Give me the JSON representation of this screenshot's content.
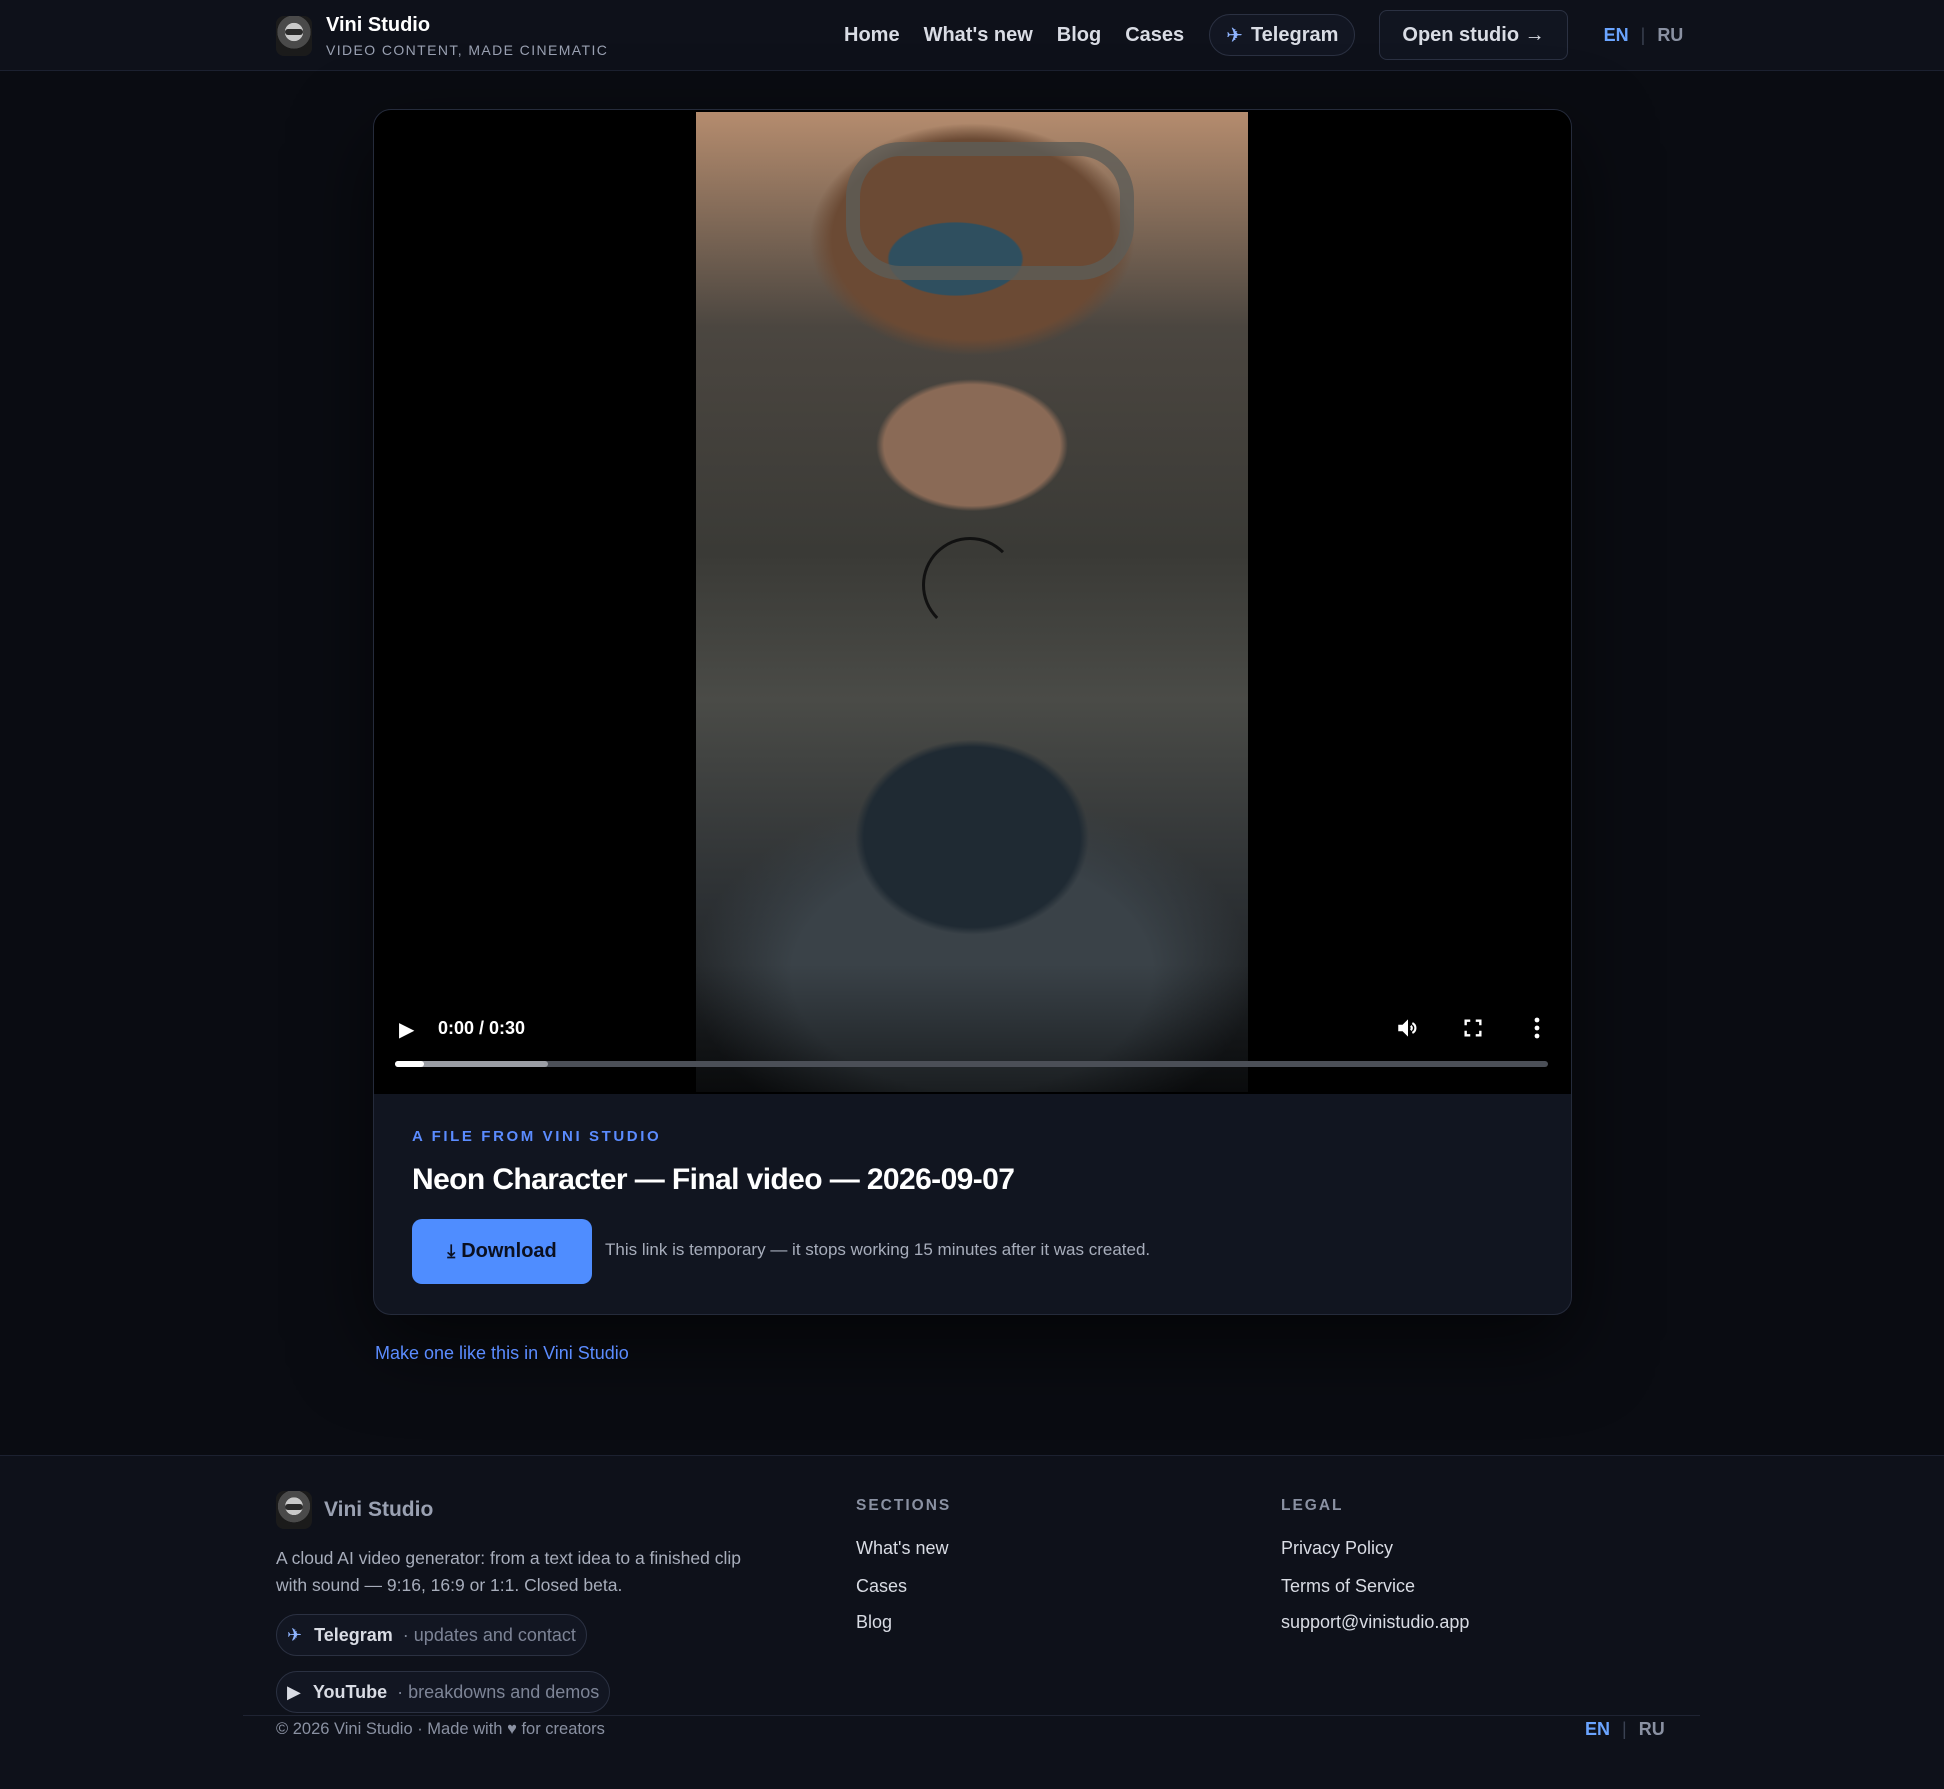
{
  "header": {
    "brand_name": "Vini Studio",
    "brand_tagline": "VIDEO CONTENT, MADE CINEMATIC",
    "nav": [
      "Home",
      "What's new",
      "Blog",
      "Cases"
    ],
    "telegram_label": "Telegram",
    "open_studio_label": "Open studio →",
    "lang_active": "EN",
    "lang_other": "RU"
  },
  "player": {
    "time": "0:00 / 0:30",
    "progress_played_fraction": 0.025,
    "progress_buffered_fraction": 0.133,
    "icons": {
      "play": "play-icon",
      "volume": "volume-icon",
      "fullscreen": "fullscreen-icon",
      "more": "more-vertical-icon",
      "loading": "loading-spinner-icon"
    }
  },
  "file": {
    "eyebrow": "A FILE FROM VINI STUDIO",
    "title": "Neon Character — Final video — 2026-09-07",
    "download_label": "Download",
    "notice": "This link is temporary — it stops working 15 minutes after it was created."
  },
  "make_link": "Make one like this in Vini Studio",
  "footer": {
    "brand_name": "Vini Studio",
    "description": "A cloud AI video generator: from a text idea to a finished clip with sound — 9:16, 16:9 or 1:1. Closed beta.",
    "social": [
      {
        "name": "Telegram",
        "sub": "· updates and contact",
        "icon": "telegram-plane-icon"
      },
      {
        "name": "YouTube",
        "sub": "· breakdowns and demos",
        "icon": "play-triangle-icon"
      }
    ],
    "sections_title": "SECTIONS",
    "sections": [
      "What's new",
      "Cases",
      "Blog"
    ],
    "legal_title": "LEGAL",
    "legal": [
      "Privacy Policy",
      "Terms of Service",
      "support@vinistudio.app"
    ],
    "copyright": "© 2026 Vini Studio · Made with ♥ for creators",
    "lang_active": "EN",
    "lang_other": "RU"
  },
  "colors": {
    "accent": "#4f8dff",
    "link": "#5b8cff",
    "background": "#0a0c12",
    "surface": "#111520"
  }
}
